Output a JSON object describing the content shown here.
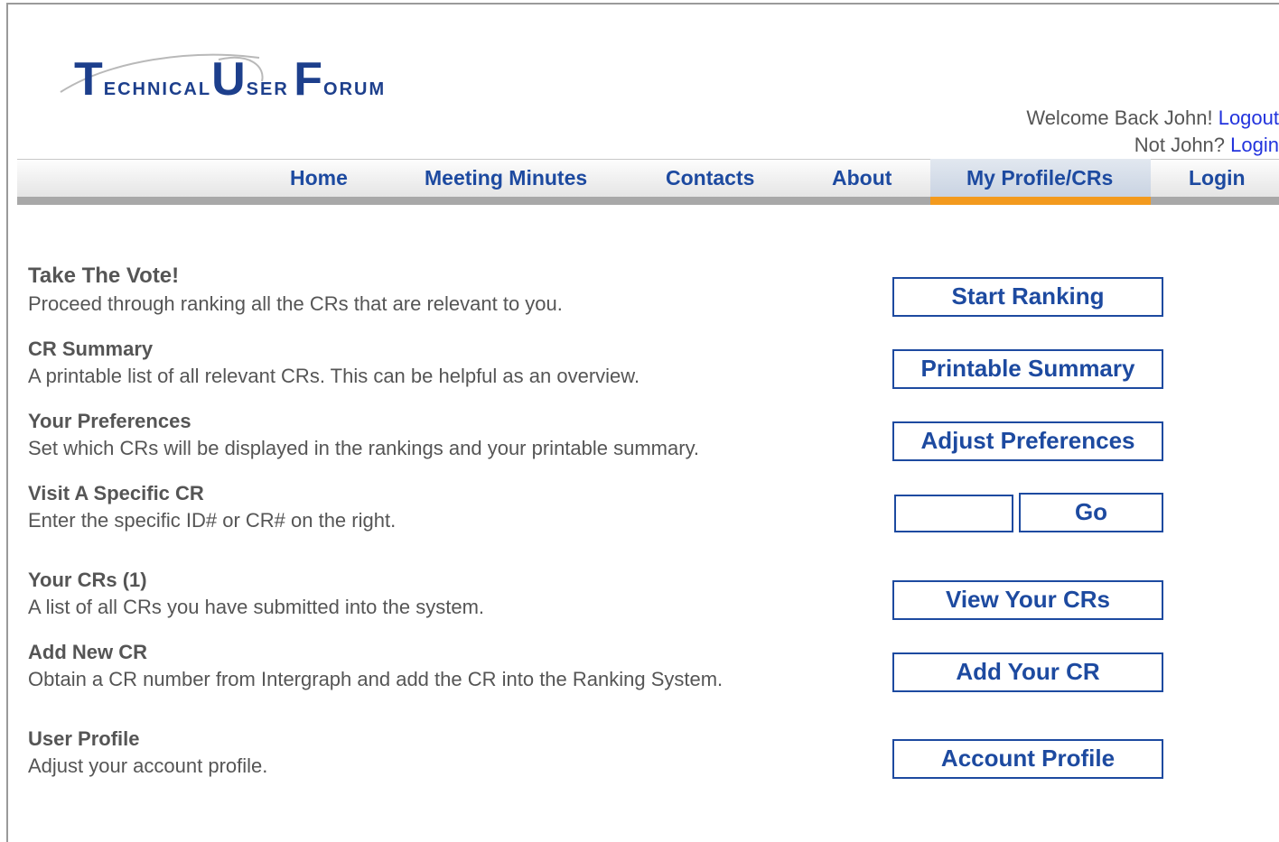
{
  "logo": {
    "t": "T",
    "echnical": "ECHNICAL",
    "u": "U",
    "ser": "SER",
    "f": "F",
    "orum": "ORUM"
  },
  "welcome": {
    "greeting": "Welcome Back John!",
    "logout": "Logout",
    "not_user": "Not John?",
    "login": "Login"
  },
  "nav": {
    "items": [
      {
        "label": "Home"
      },
      {
        "label": "Meeting Minutes"
      },
      {
        "label": "Contacts"
      },
      {
        "label": "About"
      },
      {
        "label": "My Profile/CRs"
      },
      {
        "label": "Login"
      }
    ],
    "active": "My Profile/CRs"
  },
  "sections": [
    {
      "title": "Take The Vote!",
      "desc": "Proceed through ranking all the CRs that are relevant to you.",
      "button": "Start Ranking"
    },
    {
      "title": "CR Summary",
      "desc": "A printable list of all relevant CRs. This can be helpful as an overview.",
      "button": "Printable Summary"
    },
    {
      "title": "Your Preferences",
      "desc": "Set which CRs will be displayed in the rankings and your printable summary.",
      "button": "Adjust Preferences"
    },
    {
      "title": "Visit A Specific CR",
      "desc": "Enter the specific ID# or CR# on the right.",
      "button": "Go"
    },
    {
      "title": "Your CRs (1)",
      "desc": "A list of all CRs you have submitted into the system.",
      "button": "View Your CRs"
    },
    {
      "title": "Add New CR",
      "desc": "Obtain a CR number from Intergraph and add the CR into the Ranking System.",
      "button": "Add Your CR"
    },
    {
      "title": "User Profile",
      "desc": "Adjust your account profile.",
      "button": "Account Profile"
    }
  ],
  "cr_input": {
    "value": "",
    "placeholder": ""
  },
  "colors": {
    "link": "#1d4aa0",
    "accent": "#f39a1e",
    "logo": "#1d3f8c"
  }
}
